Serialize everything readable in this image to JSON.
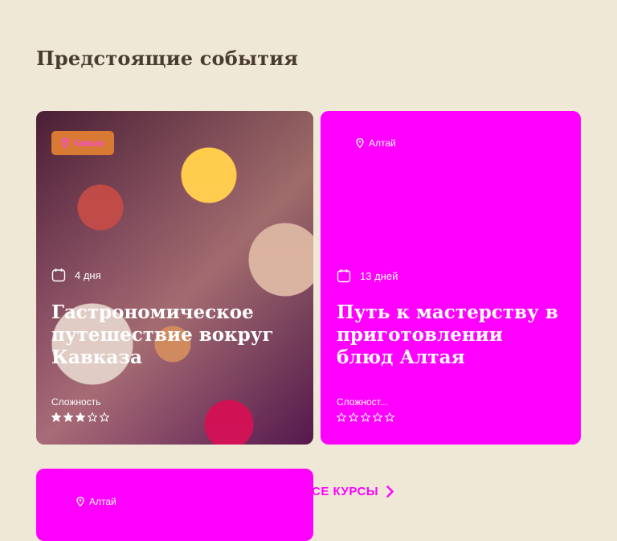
{
  "section": {
    "title": "Предстоящие события"
  },
  "cards": [
    {
      "location": "Кавказ",
      "duration": "4 дня",
      "title": "Гастрономическое путешествие вокруг Кавказа",
      "difficulty_label": "Сложность",
      "rating": 3,
      "rating_max": 5
    },
    {
      "location": "Алтай",
      "duration": "13 дней",
      "title": "Путь к мастерству в приготовлении блюд Алтая",
      "difficulty_label": "Сложност...",
      "rating": 0,
      "rating_max": 5
    },
    {
      "location": "Алтай"
    }
  ],
  "cta": {
    "label": "СЕ КУРСЫ"
  },
  "colors": {
    "accent": "#ff00ff",
    "badge": "#d87a33",
    "background": "#f0e8d6",
    "title": "#4a3b31"
  },
  "icons": {
    "location": "map-pin-icon",
    "duration": "calendar-icon",
    "cta": "chevron-right-icon",
    "rating": "star-icon"
  }
}
